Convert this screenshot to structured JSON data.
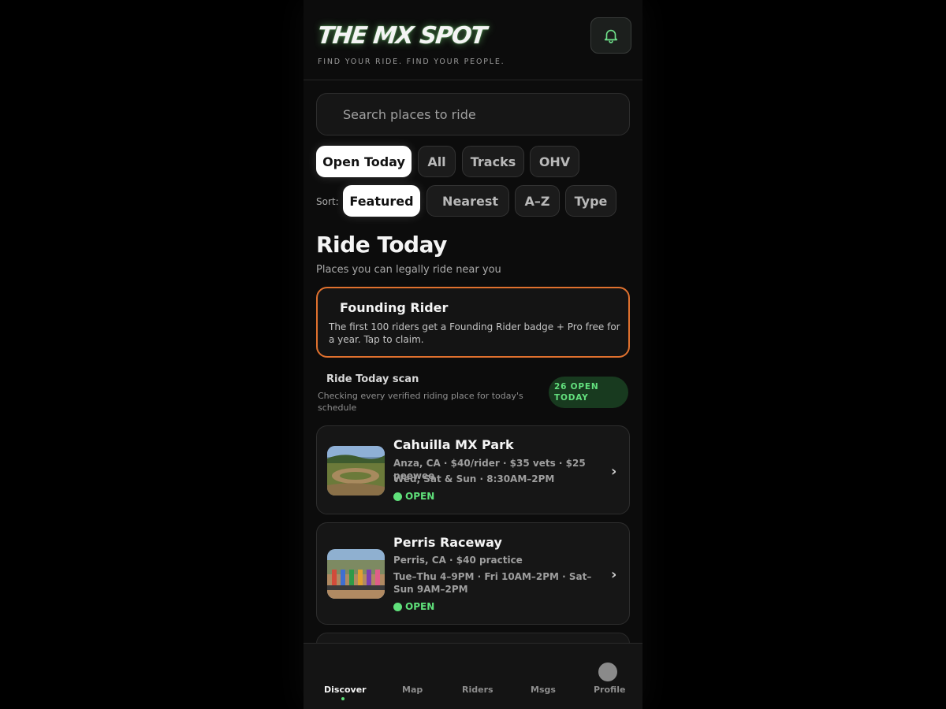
{
  "header": {
    "logo": "THE MX SPOT",
    "tagline": "FIND YOUR RIDE. FIND YOUR PEOPLE.",
    "bell_icon": "bell-icon"
  },
  "search": {
    "placeholder": "Search places to ride"
  },
  "filters": [
    {
      "label": "Open Today",
      "active": true
    },
    {
      "label": "All",
      "active": false
    },
    {
      "label": "Tracks",
      "active": false
    },
    {
      "label": "OHV",
      "active": false
    }
  ],
  "sort": {
    "label": "Sort:",
    "options": [
      {
        "label": "Featured",
        "active": true
      },
      {
        "label": "Nearest",
        "active": false
      },
      {
        "label": "A–Z",
        "active": false
      },
      {
        "label": "Type",
        "active": false
      }
    ]
  },
  "section": {
    "title": "Ride Today",
    "subtitle": "Places you can legally ride near you"
  },
  "promo": {
    "title": "Founding Rider",
    "text": "The first 100 riders get a Founding Rider badge + Pro free for a year. Tap to claim."
  },
  "scan": {
    "title": "Ride Today scan",
    "subtitle": "Checking every verified riding place for today's schedule",
    "badge": "26 OPEN TODAY"
  },
  "places": [
    {
      "name": "Cahuilla MX Park",
      "details": "Anza, CA · $40/rider · $35 vets · $25 peewee",
      "hours": "Wed, Sat & Sun · 8:30AM–2PM",
      "status": "OPEN"
    },
    {
      "name": "Perris Raceway",
      "details": "Perris, CA · $40 practice",
      "hours": "Tue–Thu 4–9PM · Fri 10AM–2PM · Sat–Sun 9AM–2PM",
      "status": "OPEN"
    }
  ],
  "nav": [
    {
      "label": "Discover",
      "active": true
    },
    {
      "label": "Map",
      "active": false
    },
    {
      "label": "Riders",
      "active": false
    },
    {
      "label": "Msgs",
      "active": false
    },
    {
      "label": "Profile",
      "active": false
    }
  ],
  "colors": {
    "accent_green": "#5fe07a",
    "promo_border": "#e0712e",
    "background": "#0c0c0c"
  }
}
